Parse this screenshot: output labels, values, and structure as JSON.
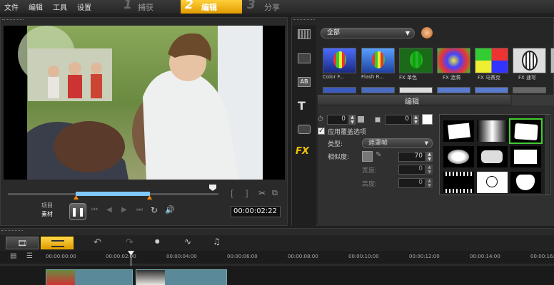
{
  "menu": {
    "file": "文件",
    "edit": "编辑",
    "tools": "工具",
    "settings": "设置"
  },
  "steps": [
    {
      "num": "1",
      "label": "捕获"
    },
    {
      "num": "2",
      "label": "编辑"
    },
    {
      "num": "3",
      "label": "分享"
    }
  ],
  "player": {
    "project_label": "项目",
    "clip_label": "素材",
    "timecode": "00:00:02:22",
    "tooltip": "暂停",
    "bracket_labels": {
      "in": "[",
      "out": "]"
    },
    "scrub_progress": 0.97
  },
  "library": {
    "category": "全部",
    "thumbnails": [
      {
        "caption": "Color F..."
      },
      {
        "caption": "Flash R..."
      },
      {
        "caption": "FX 单色"
      },
      {
        "caption": "FX 涟漪"
      },
      {
        "caption": "FX 马赛克"
      },
      {
        "caption": "FX 速写"
      }
    ]
  },
  "editpanel": {
    "tab_label": "编辑",
    "duration_a": "0",
    "duration_b": "0",
    "apply_overlay": "应用覆盖选项",
    "type_label": "类型:",
    "type_value": "遮罩帧",
    "similarity_label": "相似度:",
    "similarity_value": "70",
    "width_label": "宽度:",
    "width_value": "0",
    "height_label": "高度:",
    "height_value": "0"
  },
  "timeline": {
    "ticks": [
      "00:00:00:00",
      "00:00:02:00",
      "00:00:04:00",
      "00:00:06:00",
      "00:00:08:00",
      "00:00:10:00",
      "00:00:12:00",
      "00:00:14:00",
      "00:00:16:00"
    ]
  },
  "colors": {
    "accent": "#f2b705",
    "selection": "#66bb44",
    "scrub": "#7ec8ff"
  }
}
